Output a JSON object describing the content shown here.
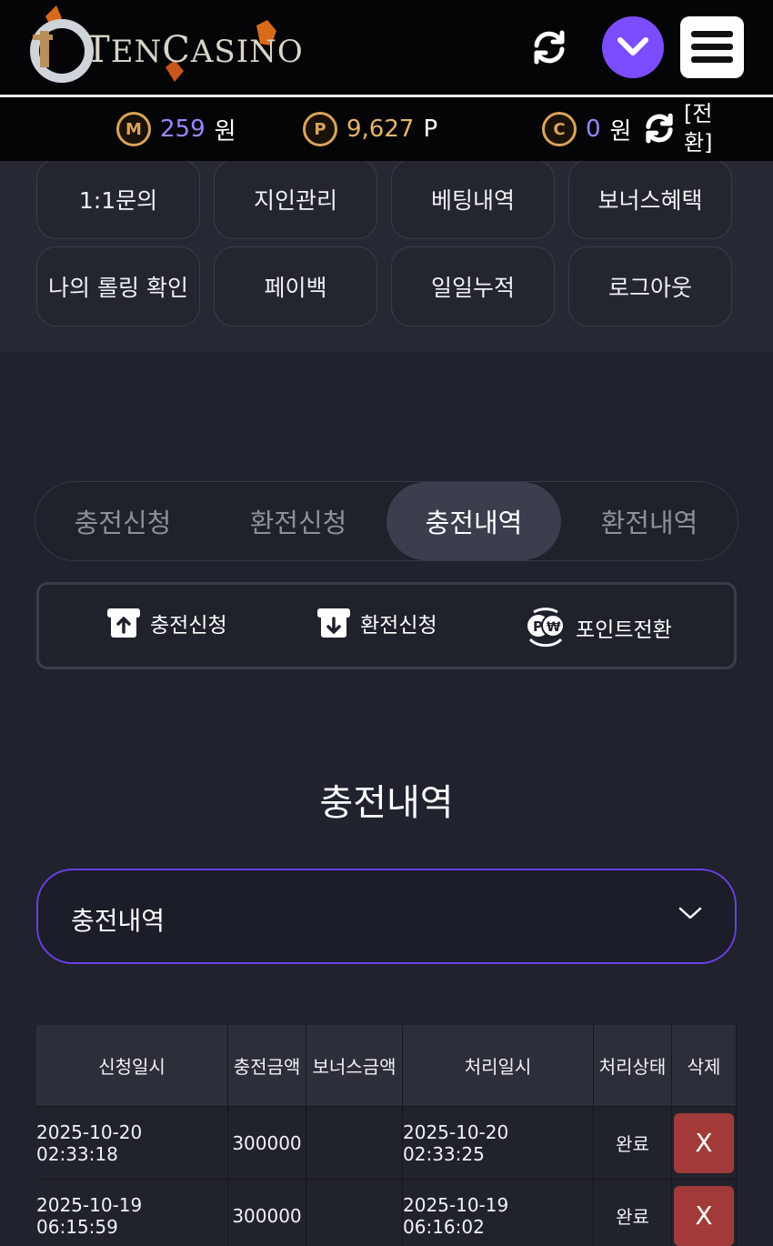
{
  "header": {
    "logo_text_1": "T",
    "logo_text_2": "EN",
    "logo_text_3": "C",
    "logo_text_4": "ASINO",
    "logo_icon": "ten-casino-logo"
  },
  "balances": {
    "money": {
      "icon": "M",
      "value": "259",
      "unit": "원"
    },
    "point": {
      "icon": "P",
      "value": "9,627",
      "unit": "P"
    },
    "casino": {
      "icon": "C",
      "value": "0",
      "unit": "원"
    },
    "convert_label": "[전환]"
  },
  "menu": {
    "items": [
      "1:1문의",
      "지인관리",
      "베팅내역",
      "보너스혜택",
      "나의 롤링 확인",
      "페이백",
      "일일누적",
      "로그아웃"
    ]
  },
  "tabs": [
    "충전신청",
    "환전신청",
    "충전내역",
    "환전내역"
  ],
  "active_tab": 2,
  "subactions": [
    {
      "label": "충전신청",
      "icon": "deposit-icon"
    },
    {
      "label": "환전신청",
      "icon": "withdraw-icon"
    },
    {
      "label": "포인트전환",
      "icon": "point-convert-icon"
    }
  ],
  "section": {
    "title": "충전내역"
  },
  "filter": {
    "selected": "충전내역"
  },
  "table": {
    "headers": [
      "신청일시",
      "충전금액",
      "보너스금액",
      "처리일시",
      "처리상태",
      "삭제"
    ],
    "rows": [
      {
        "request_time": "2025-10-20 02:33:18",
        "amount": "300000",
        "bonus": "",
        "process_time": "2025-10-20 02:33:25",
        "status": "완료",
        "delete": "X"
      },
      {
        "request_time": "2025-10-19 06:15:59",
        "amount": "300000",
        "bonus": "",
        "process_time": "2025-10-19 06:16:02",
        "status": "완료",
        "delete": "X"
      }
    ]
  },
  "colors": {
    "accent": "#7b4dff",
    "money_value": "#9a86ff",
    "point_value": "#e7b56a",
    "delete_button": "#a23a3a"
  }
}
